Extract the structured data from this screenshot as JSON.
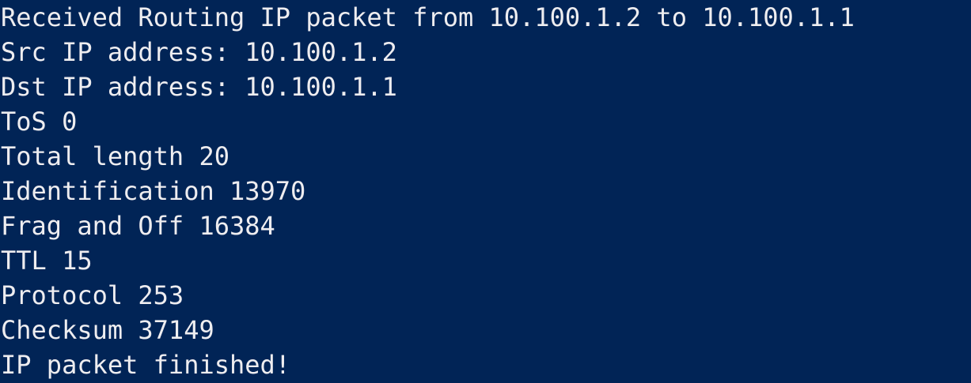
{
  "terminal": {
    "background": "#012456",
    "foreground": "#eeedf0",
    "lines": [
      "Received Routing IP packet from 10.100.1.2 to 10.100.1.1",
      "Src IP address: 10.100.1.2",
      "Dst IP address: 10.100.1.1",
      "ToS 0",
      "Total length 20",
      "Identification 13970",
      "Frag and Off 16384",
      "TTL 15",
      "Protocol 253",
      "Checksum 37149",
      "IP packet finished!"
    ]
  }
}
